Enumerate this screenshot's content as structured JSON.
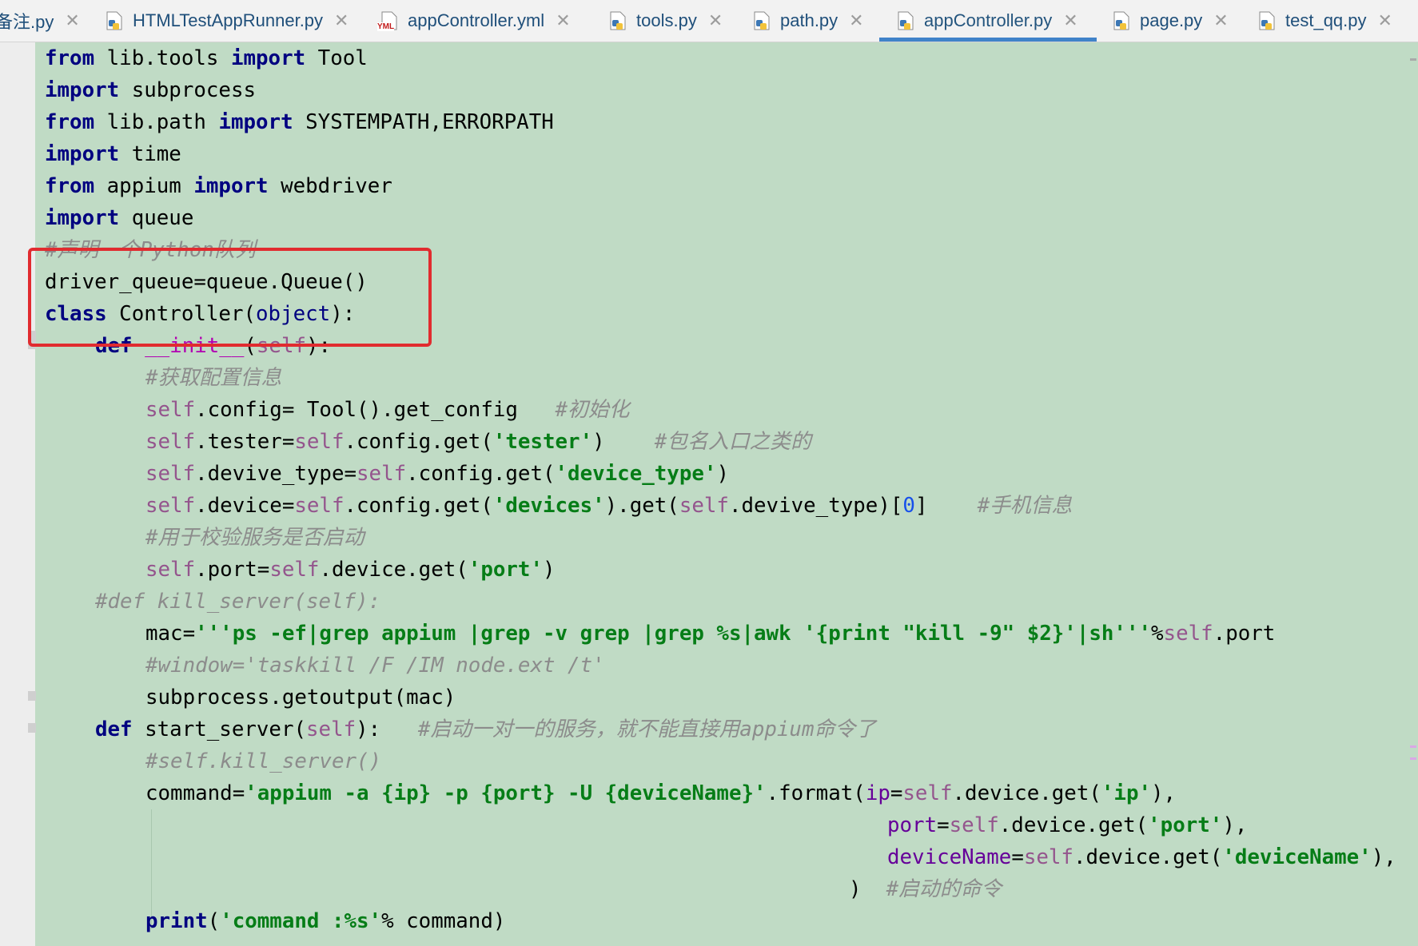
{
  "tabs": [
    {
      "label": "备注.py",
      "icon": "python-file-icon",
      "active": false
    },
    {
      "label": "HTMLTestAppRunner.py",
      "icon": "python-file-icon",
      "active": false
    },
    {
      "label": "appController.yml",
      "icon": "yaml-file-icon",
      "active": false
    },
    {
      "label": "tools.py",
      "icon": "python-file-icon",
      "active": false
    },
    {
      "label": "path.py",
      "icon": "python-file-icon",
      "active": false
    },
    {
      "label": "appController.py",
      "icon": "python-file-icon",
      "active": true
    },
    {
      "label": "page.py",
      "icon": "python-file-icon",
      "active": false
    },
    {
      "label": "test_qq.py",
      "icon": "python-file-icon",
      "active": false
    }
  ],
  "yml_badge": "YML",
  "close_glyph": "✕",
  "code": {
    "l1": {
      "a": "from",
      "b": " lib.tools ",
      "c": "import",
      "d": " Tool"
    },
    "l2": {
      "a": "import",
      "b": " subprocess"
    },
    "l3": {
      "a": "from",
      "b": " lib.path ",
      "c": "import",
      "d": " SYSTEMPATH,ERRORPATH"
    },
    "l4": {
      "a": "import",
      "b": " time"
    },
    "l5": {
      "a": "from",
      "b": " appium ",
      "c": "import",
      "d": " webdriver"
    },
    "l6": {
      "a": "import",
      "b": " queue"
    },
    "l7": {
      "cm": "#声明一个Python队列"
    },
    "l8": {
      "a": "driver_queue=queue.Queue()"
    },
    "l9": {
      "a": "class",
      "b": " Controller(",
      "c": "object",
      "d": "):"
    },
    "l10": {
      "a": "def",
      "b": " ",
      "c": "__init__",
      "d": "(",
      "e": "self",
      "f": "):"
    },
    "l11": {
      "cm": "#获取配置信息"
    },
    "l12": {
      "a": "self",
      "b": ".config= Tool().get_config   ",
      "cm": "#初始化"
    },
    "l13": {
      "a": "self",
      "b": ".tester=",
      "c": "self",
      "d": ".config.get(",
      "e": "'tester'",
      "f": ")    ",
      "cm": "#包名入口之类的"
    },
    "l14": {
      "a": "self",
      "b": ".devive_type=",
      "c": "self",
      "d": ".config.get(",
      "e": "'device_type'",
      "f": ")"
    },
    "l15": {
      "a": "self",
      "b": ".device=",
      "c": "self",
      "d": ".config.get(",
      "e": "'devices'",
      "f": ").get(",
      "g": "self",
      "h": ".devive_type)[",
      "i": "0",
      "j": "]    ",
      "cm": "#手机信息"
    },
    "l16": {
      "cm": "#用于校验服务是否启动"
    },
    "l17": {
      "a": "self",
      "b": ".port=",
      "c": "self",
      "d": ".device.get(",
      "e": "'port'",
      "f": ")"
    },
    "l18": {
      "cm": "#def kill_server(self):"
    },
    "l19": {
      "a": "mac=",
      "b": "'''ps -ef|grep appium |grep -v grep |grep %s|awk '{print \"kill -9\" $2}'|sh'''",
      "c": "%",
      "d": "self",
      "e": ".port"
    },
    "l20": {
      "cm": "#window='taskkill /F /IM node.ext /t'"
    },
    "l21": {
      "a": "subprocess.getoutput(mac)"
    },
    "l22": {
      "a": "def",
      "b": " start_server(",
      "c": "self",
      "d": "):   ",
      "cm": "#启动一对一的服务，就不能直接用appium命令了"
    },
    "l23": {
      "cm": "#self.kill_server()"
    },
    "l24": {
      "a": "command=",
      "b": "'appium -a {ip} -p {port} -U {deviceName}'",
      "c": ".format(",
      "d": "ip",
      "e": "=",
      "f": "self",
      "g": ".device.get(",
      "h": "'ip'",
      "i": "),"
    },
    "l25": {
      "a": "port",
      "b": "=",
      "c": "self",
      "d": ".device.get(",
      "e": "'port'",
      "f": "),"
    },
    "l26": {
      "a": "deviceName",
      "b": "=",
      "c": "self",
      "d": ".device.get(",
      "e": "'deviceName'",
      "f": "),"
    },
    "l27": {
      "a": ")  ",
      "cm": "#启动的命令"
    },
    "l28": {
      "a": "print",
      "b": "(",
      "c": "'command :%s'",
      "d": "% command)"
    }
  }
}
